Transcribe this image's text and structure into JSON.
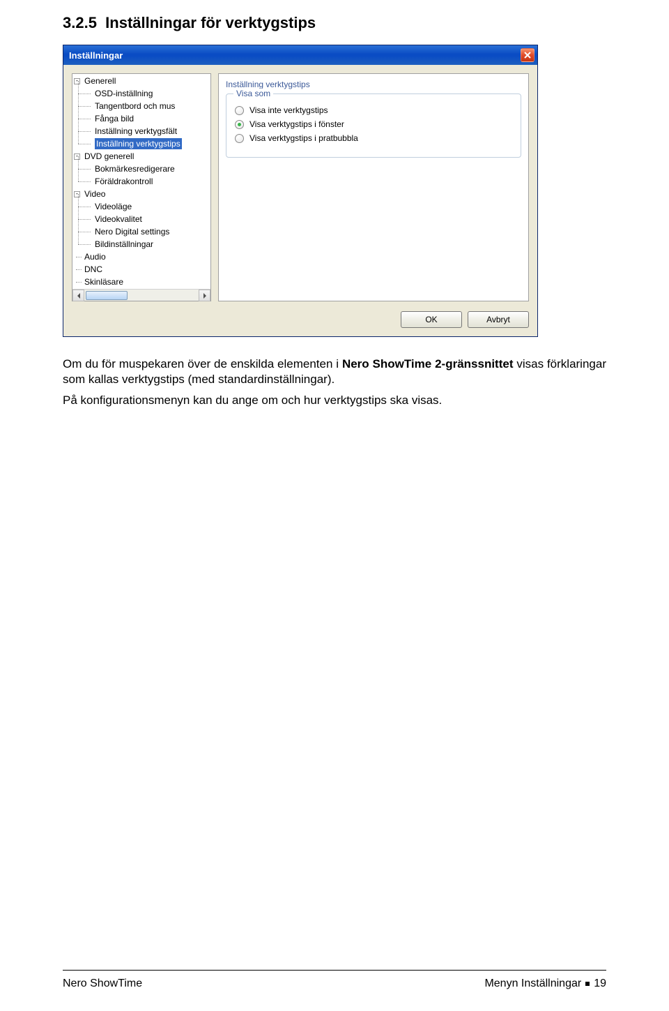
{
  "heading": {
    "number": "3.2.5",
    "title": "Inställningar för verktygstips"
  },
  "dialog": {
    "title": "Inställningar",
    "tree": {
      "nodes": [
        {
          "label": "Generell",
          "level": 1,
          "toggle": "-"
        },
        {
          "label": "OSD-inställning",
          "level": 2
        },
        {
          "label": "Tangentbord och mus",
          "level": 2
        },
        {
          "label": "Fånga bild",
          "level": 2
        },
        {
          "label": "Inställning verktygsfält",
          "level": 2
        },
        {
          "label": "Inställning verktygstips",
          "level": 2,
          "selected": true
        },
        {
          "label": "DVD generell",
          "level": 1,
          "toggle": "-"
        },
        {
          "label": "Bokmärkesredigerare",
          "level": 2
        },
        {
          "label": "Föräldrakontroll",
          "level": 2
        },
        {
          "label": "Video",
          "level": 1,
          "toggle": "-"
        },
        {
          "label": "Videoläge",
          "level": 2
        },
        {
          "label": "Videokvalitet",
          "level": 2
        },
        {
          "label": "Nero Digital settings",
          "level": 2
        },
        {
          "label": "Bildinställningar",
          "level": 2
        },
        {
          "label": "Audio",
          "level": 1,
          "toggle": ""
        },
        {
          "label": "DNC",
          "level": 1,
          "toggle": ""
        },
        {
          "label": "Skinläsare",
          "level": 1,
          "toggle": ""
        }
      ]
    },
    "settings": {
      "sectionTitle": "Inställning verktygstips",
      "groupLabel": "Visa som",
      "options": [
        {
          "label": "Visa inte verktygstips",
          "checked": false
        },
        {
          "label": "Visa verktygstips i fönster",
          "checked": true
        },
        {
          "label": "Visa verktygstips i pratbubbla",
          "checked": false
        }
      ]
    },
    "buttons": {
      "ok": "OK",
      "cancel": "Avbryt"
    }
  },
  "body": {
    "p1a": "Om du för muspekaren över de enskilda elementen i ",
    "p1bold": "Nero ShowTime 2-gränssnittet",
    "p1b": " visas förklaringar som kallas verktygstips (med standardinställningar).",
    "p2": "På konfigurationsmenyn kan du ange om och hur verktygstips ska visas."
  },
  "footer": {
    "left": "Nero ShowTime",
    "rightText": "Menyn Inställningar",
    "pageNumber": "19"
  }
}
